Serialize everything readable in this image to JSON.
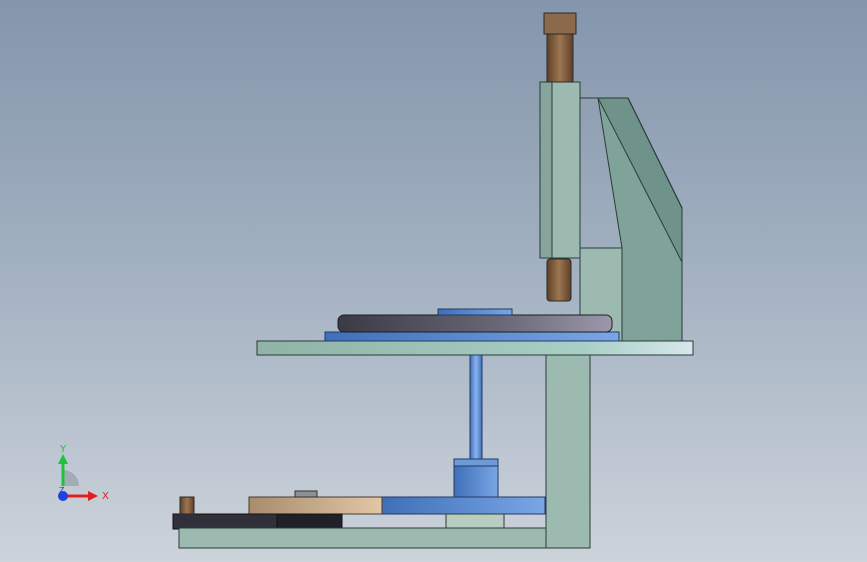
{
  "triad": {
    "x_label": "X",
    "y_label": "Y",
    "z_label": "Z"
  },
  "colors": {
    "background_top": "#8396ab",
    "background_bottom": "#cdd3db",
    "frame_green": "#9dbab1",
    "frame_dark": "#6f8f86",
    "bronze": "#7a5a3c",
    "steel_blue": "#4f7fc6",
    "dark_disc": "#3a3a45",
    "tan_gear": "#c9ad8c",
    "axis_x": "#e02020",
    "axis_y": "#20c040",
    "axis_z": "#2040e0"
  }
}
